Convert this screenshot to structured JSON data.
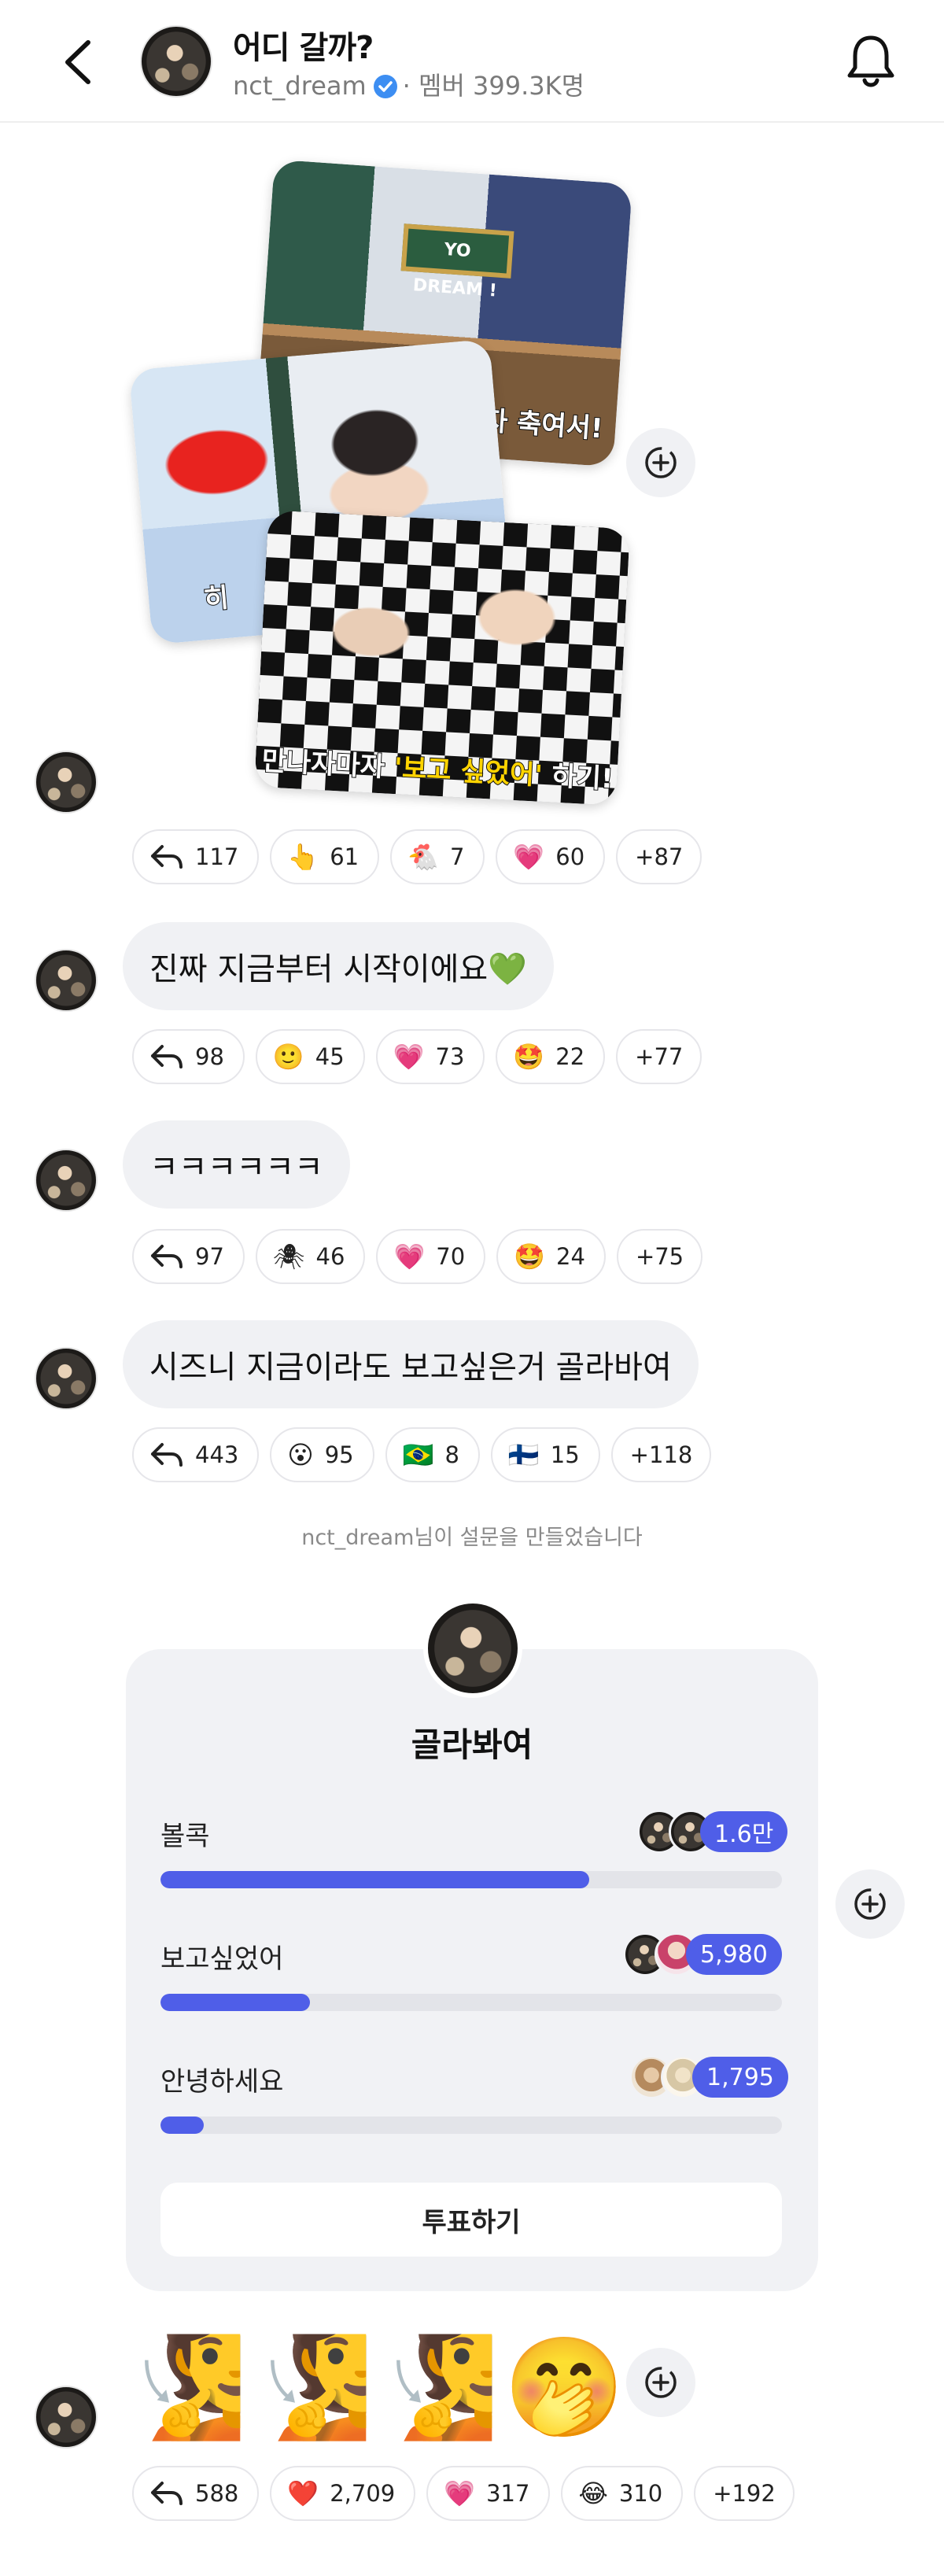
{
  "header": {
    "title": "어디 갈까?",
    "channel": "nct_dream",
    "members_label": "· 멤버 399.3K명"
  },
  "collage": {
    "photo1_sign": "YO DREAM !",
    "photo1_caption": "자 축여서!",
    "photo2_caption": "히",
    "photo3_caption_a": "만나자마자 ",
    "photo3_caption_b": "'보고 싶었어'",
    "photo3_caption_c": " 하기!"
  },
  "messages": [
    {
      "text": "",
      "reactions": [
        {
          "emoji": "",
          "count": "117"
        },
        {
          "emoji": "👆",
          "count": "61"
        },
        {
          "emoji": "🐔",
          "count": "7"
        },
        {
          "emoji": "💗",
          "count": "60"
        }
      ],
      "more": "+87"
    },
    {
      "text": "진짜 지금부터 시작이에요💚",
      "reactions": [
        {
          "emoji": "",
          "count": "98"
        },
        {
          "emoji": "🙂",
          "count": "45"
        },
        {
          "emoji": "💗",
          "count": "73"
        },
        {
          "emoji": "🤩",
          "count": "22"
        }
      ],
      "more": "+77"
    },
    {
      "text": "ㅋㅋㅋㅋㅋㅋ",
      "reactions": [
        {
          "emoji": "",
          "count": "97"
        },
        {
          "emoji": "🕷",
          "count": "46"
        },
        {
          "emoji": "💗",
          "count": "70"
        },
        {
          "emoji": "🤩",
          "count": "24"
        }
      ],
      "more": "+75"
    },
    {
      "text": "시즈니 지금이라도 보고싶은거 골라바여",
      "reactions": [
        {
          "emoji": "",
          "count": "443"
        },
        {
          "emoji": "😮",
          "count": "95"
        },
        {
          "emoji": "🇧🇷",
          "count": "8"
        },
        {
          "emoji": "🇫🇮",
          "count": "15"
        }
      ],
      "more": "+118"
    }
  ],
  "system_notice": "nct_dream님이 설문을 만들었습니다",
  "poll": {
    "title": "골라봐여",
    "options": [
      {
        "label": "볼콕",
        "count": "1.6만",
        "fraction": 0.69
      },
      {
        "label": "보고싶었어",
        "count": "5,980",
        "fraction": 0.24
      },
      {
        "label": "안녕하세요",
        "count": "1,795",
        "fraction": 0.07
      }
    ],
    "vote_button": "투표하기"
  },
  "last_message": {
    "stickers": [
      "🧏",
      "🧏",
      "🧏",
      "🤭"
    ],
    "reactions": [
      {
        "emoji": "",
        "count": "588"
      },
      {
        "emoji": "❤️",
        "count": "2,709"
      },
      {
        "emoji": "💗",
        "count": "317"
      },
      {
        "emoji": "😂",
        "count": "310"
      }
    ],
    "more": "+192"
  },
  "colors": {
    "accent": "#4f5ee8",
    "bubble": "#f0f1f4",
    "verified": "#3d8ef2"
  }
}
